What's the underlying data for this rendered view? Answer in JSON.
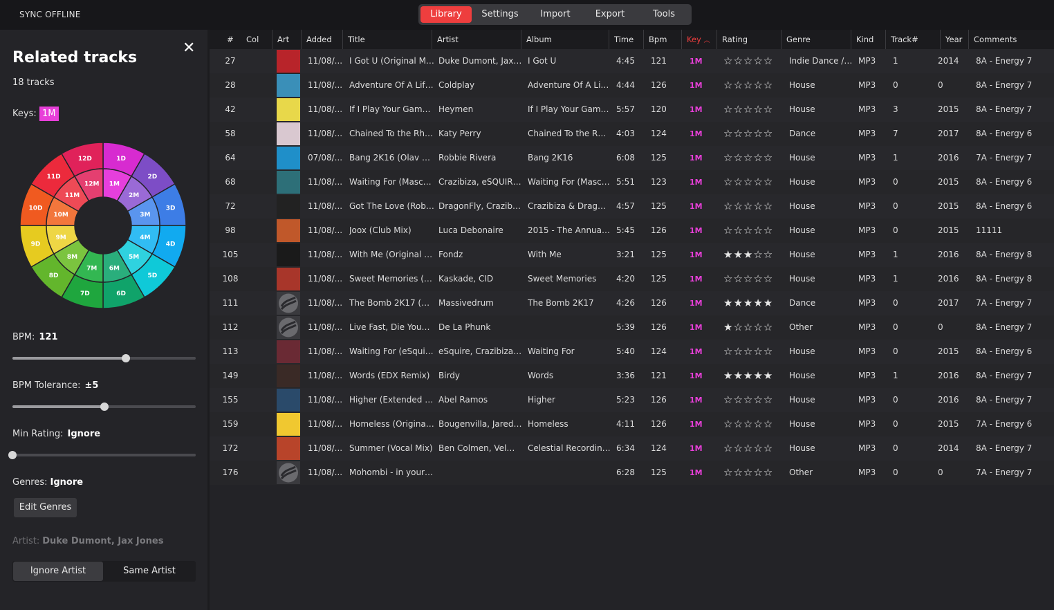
{
  "app": {
    "sync_status": "SYNC OFFLINE"
  },
  "nav": {
    "tabs": [
      "Library",
      "Settings",
      "Import",
      "Export",
      "Tools"
    ],
    "active": "Library"
  },
  "sidebar": {
    "title": "Related tracks",
    "count": "18 tracks",
    "keys_label": "Keys:",
    "keys_value": "1M",
    "bpm_label": "BPM:",
    "bpm_value": "121",
    "bpm_slider_level": 0.62,
    "tolerance_label": "BPM Tolerance:",
    "tolerance_value": "±5",
    "tolerance_slider_level": 0.5,
    "rating_label": "Min Rating:",
    "rating_value": "Ignore",
    "rating_slider_level": 0,
    "genres_label": "Genres:",
    "genres_value": "Ignore",
    "edit_genres": "Edit Genres",
    "artist_label": "Artist:",
    "artist_value": "Duke Dumont, Jax Jones",
    "artist_options": [
      "Ignore Artist",
      "Same Artist"
    ],
    "artist_selected": "Ignore Artist"
  },
  "wheel": {
    "outer": [
      {
        "key": "1D",
        "color": "#d72bd0"
      },
      {
        "key": "2D",
        "color": "#7d4dc6"
      },
      {
        "key": "3D",
        "color": "#3d7de6"
      },
      {
        "key": "4D",
        "color": "#11aaf0"
      },
      {
        "key": "5D",
        "color": "#0fc9d8"
      },
      {
        "key": "6D",
        "color": "#10a36a"
      },
      {
        "key": "7D",
        "color": "#1fa63e"
      },
      {
        "key": "8D",
        "color": "#63b62c"
      },
      {
        "key": "9D",
        "color": "#e6cb20"
      },
      {
        "key": "10D",
        "color": "#f05a20"
      },
      {
        "key": "11D",
        "color": "#ec2a3c"
      },
      {
        "key": "12D",
        "color": "#e0225a"
      }
    ],
    "inner": [
      {
        "key": "1M",
        "color": "#e63fdc"
      },
      {
        "key": "2M",
        "color": "#9a6ad6"
      },
      {
        "key": "3M",
        "color": "#5a95ee"
      },
      {
        "key": "4M",
        "color": "#31bcf3"
      },
      {
        "key": "5M",
        "color": "#2fd2df"
      },
      {
        "key": "6M",
        "color": "#2aae7c"
      },
      {
        "key": "7M",
        "color": "#33b752"
      },
      {
        "key": "8M",
        "color": "#7bc43f"
      },
      {
        "key": "9M",
        "color": "#eed645"
      },
      {
        "key": "10M",
        "color": "#f2763c"
      },
      {
        "key": "11M",
        "color": "#ee4a56"
      },
      {
        "key": "12M",
        "color": "#e43f70"
      }
    ]
  },
  "table": {
    "columns": [
      "#",
      "Col",
      "Art",
      "Added",
      "Title",
      "Artist",
      "Album",
      "Time",
      "Bpm",
      "Key",
      "Rating",
      "Genre",
      "Kind",
      "Track#",
      "Year",
      "Comments"
    ],
    "sort_column": "Key",
    "rows": [
      {
        "num": "27",
        "added": "11/08/...",
        "title": "I Got U (Original Mix)",
        "artist": "Duke Dumont, Jax J...",
        "album": "I Got U",
        "time": "4:45",
        "bpm": "121",
        "key": "1M",
        "rating": 0,
        "genre": "Indie Dance / N...",
        "kind": "MP3",
        "track": "1",
        "year": "2014",
        "comments": "8A - Energy 7",
        "art": "#b8242a"
      },
      {
        "num": "28",
        "added": "11/08/...",
        "title": "Adventure Of A Life...",
        "artist": "Coldplay",
        "album": "Adventure Of A Life...",
        "time": "4:44",
        "bpm": "126",
        "key": "1M",
        "rating": 0,
        "genre": "House",
        "kind": "MP3",
        "track": "0",
        "year": "0",
        "comments": "8A - Energy 7",
        "art": "#3a8fb8"
      },
      {
        "num": "42",
        "added": "11/08/...",
        "title": "If I Play Your Game (...",
        "artist": "Heymen",
        "album": "If I Play Your Game (...",
        "time": "5:57",
        "bpm": "120",
        "key": "1M",
        "rating": 0,
        "genre": "House",
        "kind": "MP3",
        "track": "3",
        "year": "2015",
        "comments": "8A - Energy 7",
        "art": "#e8d84a"
      },
      {
        "num": "58",
        "added": "11/08/...",
        "title": "Chained To the Rhyt...",
        "artist": "Katy Perry",
        "album": "Chained To the Rhyt...",
        "time": "4:03",
        "bpm": "124",
        "key": "1M",
        "rating": 0,
        "genre": "Dance",
        "kind": "MP3",
        "track": "7",
        "year": "2017",
        "comments": "8A - Energy 6",
        "art": "#d9c8d0"
      },
      {
        "num": "64",
        "added": "07/08/...",
        "title": "Bang 2K16 (Olav Ba...",
        "artist": "Robbie Rivera",
        "album": "Bang 2K16",
        "time": "6:08",
        "bpm": "125",
        "key": "1M",
        "rating": 0,
        "genre": "House",
        "kind": "MP3",
        "track": "1",
        "year": "2016",
        "comments": "7A - Energy 7",
        "art": "#1f8fc9"
      },
      {
        "num": "68",
        "added": "11/08/...",
        "title": "Waiting For (Masco...",
        "artist": "Crazibiza, eSQUIRE, ...",
        "album": "Waiting For (Masco...",
        "time": "5:51",
        "bpm": "123",
        "key": "1M",
        "rating": 0,
        "genre": "House",
        "kind": "MP3",
        "track": "0",
        "year": "2015",
        "comments": "8A - Energy 6",
        "art": "#2d6f78"
      },
      {
        "num": "72",
        "added": "11/08/...",
        "title": "Got The Love (Robe...",
        "artist": "DragonFly, Crazibiza",
        "album": "Crazibiza & Dragon...",
        "time": "4:57",
        "bpm": "125",
        "key": "1M",
        "rating": 0,
        "genre": "House",
        "kind": "MP3",
        "track": "0",
        "year": "2015",
        "comments": "8A - Energy 6",
        "art": "#222"
      },
      {
        "num": "98",
        "added": "11/08/...",
        "title": "Joox (Club Mix)",
        "artist": "Luca Debonaire",
        "album": "2015 - The Annual ...",
        "time": "5:45",
        "bpm": "126",
        "key": "1M",
        "rating": 0,
        "genre": "House",
        "kind": "MP3",
        "track": "0",
        "year": "2015",
        "comments": "11111",
        "art": "#c0582a"
      },
      {
        "num": "105",
        "added": "11/08/...",
        "title": "With Me (Original M...",
        "artist": "Fondz",
        "album": "With Me",
        "time": "3:21",
        "bpm": "125",
        "key": "1M",
        "rating": 3,
        "genre": "House",
        "kind": "MP3",
        "track": "1",
        "year": "2016",
        "comments": "8A - Energy 8",
        "art": "#1a1a1a"
      },
      {
        "num": "108",
        "added": "11/08/...",
        "title": "Sweet Memories (Ex...",
        "artist": "Kaskade, CID",
        "album": "Sweet Memories",
        "time": "4:20",
        "bpm": "125",
        "key": "1M",
        "rating": 0,
        "genre": "House",
        "kind": "MP3",
        "track": "1",
        "year": "2016",
        "comments": "8A - Energy 8",
        "art": "#a8362a"
      },
      {
        "num": "111",
        "added": "11/08/...",
        "title": "The Bomb 2K17 (Or...",
        "artist": "Massivedrum",
        "album": "The Bomb 2K17",
        "time": "4:26",
        "bpm": "126",
        "key": "1M",
        "rating": 5,
        "genre": "Dance",
        "kind": "MP3",
        "track": "0",
        "year": "2017",
        "comments": "7A - Energy 7",
        "art": "#3a3a3e"
      },
      {
        "num": "112",
        "added": "11/08/...",
        "title": "Live Fast, Die Young...",
        "artist": "De La Phunk",
        "album": "",
        "time": "5:39",
        "bpm": "126",
        "key": "1M",
        "rating": 1,
        "genre": "Other",
        "kind": "MP3",
        "track": "0",
        "year": "0",
        "comments": "8A - Energy 7",
        "art": "#3a3a3e"
      },
      {
        "num": "113",
        "added": "11/08/...",
        "title": "Waiting For (eSquir...",
        "artist": "eSquire, Crazibiza, K...",
        "album": "Waiting For",
        "time": "5:40",
        "bpm": "124",
        "key": "1M",
        "rating": 0,
        "genre": "House",
        "kind": "MP3",
        "track": "0",
        "year": "2015",
        "comments": "8A - Energy 6",
        "art": "#6a2a34"
      },
      {
        "num": "149",
        "added": "11/08/...",
        "title": "Words (EDX Remix)",
        "artist": "Birdy",
        "album": "Words",
        "time": "3:36",
        "bpm": "121",
        "key": "1M",
        "rating": 5,
        "genre": "House",
        "kind": "MP3",
        "track": "1",
        "year": "2016",
        "comments": "8A - Energy 7",
        "art": "#3a2a26"
      },
      {
        "num": "155",
        "added": "11/08/...",
        "title": "Higher (Extended Mi...",
        "artist": "Abel Ramos",
        "album": "Higher",
        "time": "5:23",
        "bpm": "126",
        "key": "1M",
        "rating": 0,
        "genre": "House",
        "kind": "MP3",
        "track": "0",
        "year": "2016",
        "comments": "8A - Energy 7",
        "art": "#2a4a6a"
      },
      {
        "num": "159",
        "added": "11/08/...",
        "title": "Homeless (Original ...",
        "artist": "Bougenvilla, Jared H...",
        "album": "Homeless",
        "time": "4:11",
        "bpm": "126",
        "key": "1M",
        "rating": 0,
        "genre": "House",
        "kind": "MP3",
        "track": "0",
        "year": "2015",
        "comments": "7A - Energy 6",
        "art": "#f0c830"
      },
      {
        "num": "172",
        "added": "11/08/...",
        "title": "Summer (Vocal Mix)",
        "artist": "Ben Colmen, Velma ...",
        "album": "Celestial Recordings",
        "time": "6:34",
        "bpm": "124",
        "key": "1M",
        "rating": 0,
        "genre": "House",
        "kind": "MP3",
        "track": "0",
        "year": "2014",
        "comments": "8A - Energy 7",
        "art": "#b8442a"
      },
      {
        "num": "176",
        "added": "11/08/...",
        "title": "Mohombi - in your h...",
        "artist": "",
        "album": "",
        "time": "6:28",
        "bpm": "125",
        "key": "1M",
        "rating": 0,
        "genre": "Other",
        "kind": "MP3",
        "track": "0",
        "year": "0",
        "comments": "7A - Energy 7",
        "art": "#3a3a3e"
      }
    ]
  },
  "colors": {
    "accent": "#ee3e3e",
    "key": "#e83fd9"
  }
}
